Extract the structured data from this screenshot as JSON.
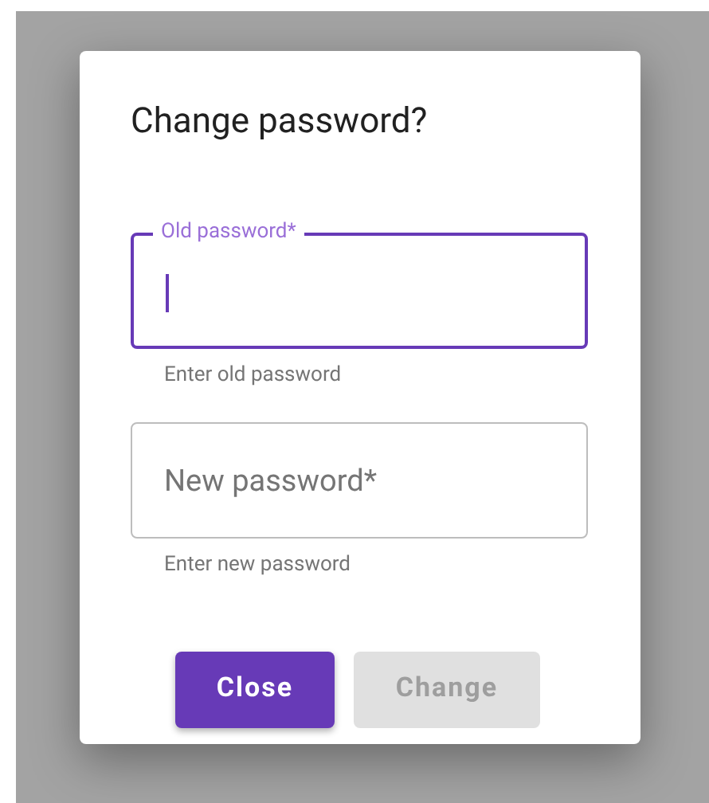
{
  "dialog": {
    "title": "Change password?",
    "fields": [
      {
        "label": "Old password*",
        "helper": "Enter old password",
        "focused": true
      },
      {
        "label": "New password*",
        "helper": "Enter new password",
        "focused": false
      }
    ],
    "buttons": [
      {
        "label": "Close",
        "disabled": false
      },
      {
        "label": "Change",
        "disabled": true
      }
    ]
  }
}
